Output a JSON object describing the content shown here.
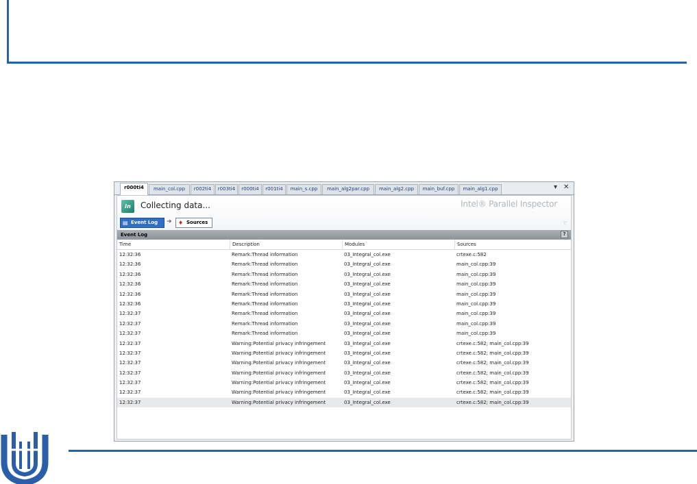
{
  "tabs": [
    {
      "label": "r000ti4",
      "active": true
    },
    {
      "label": "main_col.cpp"
    },
    {
      "label": "r002ti4"
    },
    {
      "label": "r003ti4"
    },
    {
      "label": "r000ti4"
    },
    {
      "label": "r001ti4"
    },
    {
      "label": "main_s.cpp"
    },
    {
      "label": "main_alg2par.cpp"
    },
    {
      "label": "main_alg2.cpp"
    },
    {
      "label": "main_buf.cpp"
    },
    {
      "label": "main_alg1.cpp"
    }
  ],
  "window_controls": {
    "dropdown": "▾",
    "close": "✕"
  },
  "header": {
    "status": "Collecting data...",
    "brand": "Intel® Parallel Inspector",
    "app_icon_text": "In"
  },
  "nav": {
    "event_log": "Event Log",
    "arrow": "➜",
    "sources": "Sources"
  },
  "section": {
    "title": "Event Log",
    "help": "?"
  },
  "table": {
    "columns": [
      "Time",
      "Description",
      "Modules",
      "Sources"
    ],
    "rows": [
      [
        "12:32:36",
        "Remark:Thread information",
        "03_Integral_col.exe",
        "crtexe.c:582"
      ],
      [
        "12:32:36",
        "Remark:Thread information",
        "03_Integral_col.exe",
        "main_col.cpp:39"
      ],
      [
        "12:32:36",
        "Remark:Thread information",
        "03_Integral_col.exe",
        "main_col.cpp:39"
      ],
      [
        "12:32:36",
        "Remark:Thread information",
        "03_Integral_col.exe",
        "main_col.cpp:39"
      ],
      [
        "12:32:36",
        "Remark:Thread information",
        "03_Integral_col.exe",
        "main_col.cpp:39"
      ],
      [
        "12:32:36",
        "Remark:Thread information",
        "03_Integral_col.exe",
        "main_col.cpp:39"
      ],
      [
        "12:32:37",
        "Remark:Thread information",
        "03_Integral_col.exe",
        "main_col.cpp:39"
      ],
      [
        "12:32:37",
        "Remark:Thread information",
        "03_Integral_col.exe",
        "main_col.cpp:39"
      ],
      [
        "12:32:37",
        "Remark:Thread information",
        "03_Integral_col.exe",
        "main_col.cpp:39"
      ],
      [
        "12:32:37",
        "Warning:Potential privacy infringement",
        "03_Integral_col.exe",
        "crtexe.c:582; main_col.cpp:39"
      ],
      [
        "12:32:37",
        "Warning:Potential privacy infringement",
        "03_Integral_col.exe",
        "crtexe.c:582; main_col.cpp:39"
      ],
      [
        "12:32:37",
        "Warning:Potential privacy infringement",
        "03_Integral_col.exe",
        "crtexe.c:582; main_col.cpp:39"
      ],
      [
        "12:32:37",
        "Warning:Potential privacy infringement",
        "03_Integral_col.exe",
        "crtexe.c:582; main_col.cpp:39"
      ],
      [
        "12:32:37",
        "Warning:Potential privacy infringement",
        "03_Integral_col.exe",
        "crtexe.c:582; main_col.cpp:39"
      ],
      [
        "12:32:37",
        "Warning:Potential privacy infringement",
        "03_Integral_col.exe",
        "crtexe.c:582; main_col.cpp:39"
      ],
      [
        "12:32:37",
        "Warning:Potential privacy infringement",
        "03_Integral_col.exe",
        "crtexe.c:582; main_col.cpp:39"
      ]
    ],
    "selected_row": 15
  },
  "colors": {
    "accent": "#2a5ea8",
    "active_button": "#2f6fc6",
    "section_bar": "#9aa0a7"
  }
}
